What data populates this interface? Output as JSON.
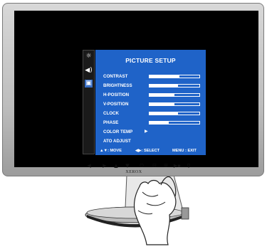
{
  "osd": {
    "title": "PICTURE SETUP",
    "side_icons": [
      {
        "name": "brightness-menu-icon",
        "glyph": "☼",
        "selected": false
      },
      {
        "name": "sound-menu-icon",
        "glyph": "◀)",
        "selected": false
      },
      {
        "name": "picture-menu-icon",
        "glyph": "▣",
        "selected": true
      }
    ],
    "items": [
      {
        "label": "CONTRAST",
        "type": "bar",
        "level_percent": 60
      },
      {
        "label": "BRIGHTNESS",
        "type": "bar",
        "level_percent": 57
      },
      {
        "label": "H-POSITION",
        "type": "bar",
        "level_percent": 50
      },
      {
        "label": "V-POSITION",
        "type": "bar",
        "level_percent": 50
      },
      {
        "label": "CLOCK",
        "type": "bar",
        "level_percent": 57
      },
      {
        "label": "PHASE",
        "type": "bar",
        "level_percent": 38
      },
      {
        "label": "COLOR TEMP",
        "type": "submenu",
        "arrow": "▶"
      },
      {
        "label": "ATO ADJUST",
        "type": "action"
      }
    ],
    "footer": {
      "move": "▲▼: MOVE",
      "select": "◀▶: SELECT",
      "exit": "MENU : EXIT"
    }
  },
  "monitor": {
    "brand": "XEROX",
    "buttons": [
      "◀",
      "▶",
      "▲",
      "▼",
      "⏻",
      "⊟",
      "⊞",
      "▶▪",
      "⚲"
    ]
  },
  "colors": {
    "osd_panel": "#1f63c8",
    "osd_text": "#ffffff",
    "screen": "#000000",
    "bezel": "#c8c8c8"
  }
}
